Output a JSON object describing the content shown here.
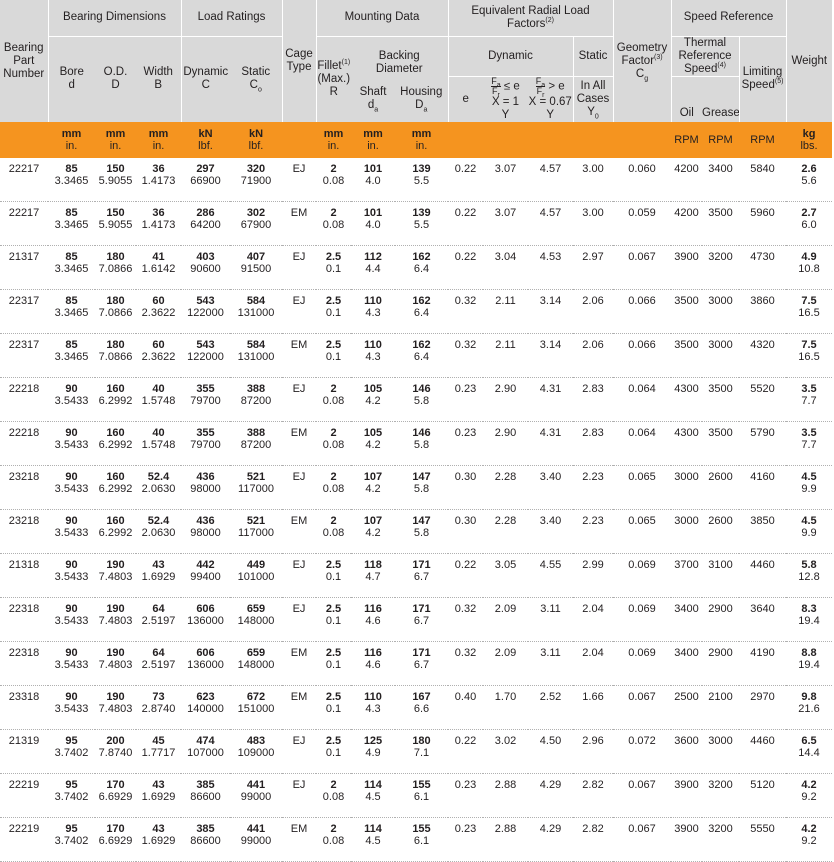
{
  "headers": {
    "bearing_part_number": "Bearing Part Number",
    "bearing_dimensions": "Bearing Dimensions",
    "bore": "Bore",
    "bore_sym": "d",
    "od": "O.D.",
    "od_sym": "D",
    "width": "Width",
    "width_sym": "B",
    "load_ratings": "Load Ratings",
    "dynamic_c": "Dynamic",
    "dynamic_c_sym": "C",
    "static_c": "Static",
    "static_c_sym": "C",
    "static_c_sub": "o",
    "cage_type": "Cage Type",
    "mounting_data": "Mounting Data",
    "fillet": "Fillet",
    "fillet_sup": "(1)",
    "fillet_max": "(Max.)",
    "fillet_sym": "R",
    "backing_diameter": "Backing Diameter",
    "shaft": "Shaft",
    "shaft_sym": "d",
    "shaft_sub": "a",
    "housing": "Housing",
    "housing_sym": "D",
    "housing_sub": "a",
    "erlf": "Equivalent Radial Load Factors",
    "erlf_sup": "(2)",
    "dynamic": "Dynamic",
    "static": "Static",
    "e": "e",
    "dyn1_rel": "≤ e",
    "dyn1_x": "X = 1",
    "dyn1_y": "Y",
    "dyn2_rel": "> e",
    "dyn2_x": "X = 0.67",
    "dyn2_y": "Y",
    "frac_num": "F",
    "frac_num_sub": "a",
    "frac_den": "F",
    "frac_den_sub": "r",
    "in_all_cases": "In All Cases",
    "y0_sym": "Y",
    "y0_sub": "0",
    "geometry_factor": "Geometry Factor",
    "geometry_sup": "(3)",
    "geometry_sym": "C",
    "geometry_sub": "g",
    "speed_reference": "Speed Reference",
    "thermal_reference_speed": "Thermal Reference Speed",
    "thermal_sup": "(4)",
    "oil": "Oil",
    "grease": "Grease",
    "limiting_speed": "Limiting Speed",
    "limiting_sup": "(5)",
    "weight": "Weight"
  },
  "units": {
    "bore": [
      "mm",
      "in."
    ],
    "od": [
      "mm",
      "in."
    ],
    "width": [
      "mm",
      "in."
    ],
    "dynamic_c": [
      "kN",
      "lbf."
    ],
    "static_c": [
      "kN",
      "lbf."
    ],
    "fillet": [
      "mm",
      "in."
    ],
    "shaft": [
      "mm",
      "in."
    ],
    "housing": [
      "mm",
      "in."
    ],
    "oil": "RPM",
    "grease": "RPM",
    "limiting": "RPM",
    "weight": [
      "kg",
      "lbs."
    ]
  },
  "rows": [
    {
      "part": "22217",
      "bore": [
        "85",
        "3.3465"
      ],
      "od": [
        "150",
        "5.9055"
      ],
      "width": [
        "36",
        "1.4173"
      ],
      "dyn": [
        "297",
        "66900"
      ],
      "stat": [
        "320",
        "71900"
      ],
      "cage": "EJ",
      "fillet": [
        "2",
        "0.08"
      ],
      "shaft": [
        "101",
        "4.0"
      ],
      "housing": [
        "139",
        "5.5"
      ],
      "e": "0.22",
      "y1": "3.07",
      "y2": "4.57",
      "y0": "3.00",
      "cg": "0.060",
      "oil": "4200",
      "grease": "3400",
      "limit": "5840",
      "weight": [
        "2.6",
        "5.6"
      ]
    },
    {
      "part": "22217",
      "bore": [
        "85",
        "3.3465"
      ],
      "od": [
        "150",
        "5.9055"
      ],
      "width": [
        "36",
        "1.4173"
      ],
      "dyn": [
        "286",
        "64200"
      ],
      "stat": [
        "302",
        "67900"
      ],
      "cage": "EM",
      "fillet": [
        "2",
        "0.08"
      ],
      "shaft": [
        "101",
        "4.0"
      ],
      "housing": [
        "139",
        "5.5"
      ],
      "e": "0.22",
      "y1": "3.07",
      "y2": "4.57",
      "y0": "3.00",
      "cg": "0.059",
      "oil": "4200",
      "grease": "3500",
      "limit": "5960",
      "weight": [
        "2.7",
        "6.0"
      ]
    },
    {
      "part": "21317",
      "bore": [
        "85",
        "3.3465"
      ],
      "od": [
        "180",
        "7.0866"
      ],
      "width": [
        "41",
        "1.6142"
      ],
      "dyn": [
        "403",
        "90600"
      ],
      "stat": [
        "407",
        "91500"
      ],
      "cage": "EJ",
      "fillet": [
        "2.5",
        "0.1"
      ],
      "shaft": [
        "112",
        "4.4"
      ],
      "housing": [
        "162",
        "6.4"
      ],
      "e": "0.22",
      "y1": "3.04",
      "y2": "4.53",
      "y0": "2.97",
      "cg": "0.067",
      "oil": "3900",
      "grease": "3200",
      "limit": "4730",
      "weight": [
        "4.9",
        "10.8"
      ]
    },
    {
      "part": "22317",
      "bore": [
        "85",
        "3.3465"
      ],
      "od": [
        "180",
        "7.0866"
      ],
      "width": [
        "60",
        "2.3622"
      ],
      "dyn": [
        "543",
        "122000"
      ],
      "stat": [
        "584",
        "131000"
      ],
      "cage": "EJ",
      "fillet": [
        "2.5",
        "0.1"
      ],
      "shaft": [
        "110",
        "4.3"
      ],
      "housing": [
        "162",
        "6.4"
      ],
      "e": "0.32",
      "y1": "2.11",
      "y2": "3.14",
      "y0": "2.06",
      "cg": "0.066",
      "oil": "3500",
      "grease": "3000",
      "limit": "3860",
      "weight": [
        "7.5",
        "16.5"
      ]
    },
    {
      "part": "22317",
      "bore": [
        "85",
        "3.3465"
      ],
      "od": [
        "180",
        "7.0866"
      ],
      "width": [
        "60",
        "2.3622"
      ],
      "dyn": [
        "543",
        "122000"
      ],
      "stat": [
        "584",
        "131000"
      ],
      "cage": "EM",
      "fillet": [
        "2.5",
        "0.1"
      ],
      "shaft": [
        "110",
        "4.3"
      ],
      "housing": [
        "162",
        "6.4"
      ],
      "e": "0.32",
      "y1": "2.11",
      "y2": "3.14",
      "y0": "2.06",
      "cg": "0.066",
      "oil": "3500",
      "grease": "3000",
      "limit": "4320",
      "weight": [
        "7.5",
        "16.5"
      ]
    },
    {
      "part": "22218",
      "bore": [
        "90",
        "3.5433"
      ],
      "od": [
        "160",
        "6.2992"
      ],
      "width": [
        "40",
        "1.5748"
      ],
      "dyn": [
        "355",
        "79700"
      ],
      "stat": [
        "388",
        "87200"
      ],
      "cage": "EJ",
      "fillet": [
        "2",
        "0.08"
      ],
      "shaft": [
        "105",
        "4.2"
      ],
      "housing": [
        "146",
        "5.8"
      ],
      "e": "0.23",
      "y1": "2.90",
      "y2": "4.31",
      "y0": "2.83",
      "cg": "0.064",
      "oil": "4300",
      "grease": "3500",
      "limit": "5520",
      "weight": [
        "3.5",
        "7.7"
      ]
    },
    {
      "part": "22218",
      "bore": [
        "90",
        "3.5433"
      ],
      "od": [
        "160",
        "6.2992"
      ],
      "width": [
        "40",
        "1.5748"
      ],
      "dyn": [
        "355",
        "79700"
      ],
      "stat": [
        "388",
        "87200"
      ],
      "cage": "EM",
      "fillet": [
        "2",
        "0.08"
      ],
      "shaft": [
        "105",
        "4.2"
      ],
      "housing": [
        "146",
        "5.8"
      ],
      "e": "0.23",
      "y1": "2.90",
      "y2": "4.31",
      "y0": "2.83",
      "cg": "0.064",
      "oil": "4300",
      "grease": "3500",
      "limit": "5790",
      "weight": [
        "3.5",
        "7.7"
      ]
    },
    {
      "part": "23218",
      "bore": [
        "90",
        "3.5433"
      ],
      "od": [
        "160",
        "6.2992"
      ],
      "width": [
        "52.4",
        "2.0630"
      ],
      "dyn": [
        "436",
        "98000"
      ],
      "stat": [
        "521",
        "117000"
      ],
      "cage": "EJ",
      "fillet": [
        "2",
        "0.08"
      ],
      "shaft": [
        "107",
        "4.2"
      ],
      "housing": [
        "147",
        "5.8"
      ],
      "e": "0.30",
      "y1": "2.28",
      "y2": "3.40",
      "y0": "2.23",
      "cg": "0.065",
      "oil": "3000",
      "grease": "2600",
      "limit": "4160",
      "weight": [
        "4.5",
        "9.9"
      ]
    },
    {
      "part": "23218",
      "bore": [
        "90",
        "3.5433"
      ],
      "od": [
        "160",
        "6.2992"
      ],
      "width": [
        "52.4",
        "2.0630"
      ],
      "dyn": [
        "436",
        "98000"
      ],
      "stat": [
        "521",
        "117000"
      ],
      "cage": "EM",
      "fillet": [
        "2",
        "0.08"
      ],
      "shaft": [
        "107",
        "4.2"
      ],
      "housing": [
        "147",
        "5.8"
      ],
      "e": "0.30",
      "y1": "2.28",
      "y2": "3.40",
      "y0": "2.23",
      "cg": "0.065",
      "oil": "3000",
      "grease": "2600",
      "limit": "3850",
      "weight": [
        "4.5",
        "9.9"
      ]
    },
    {
      "part": "21318",
      "bore": [
        "90",
        "3.5433"
      ],
      "od": [
        "190",
        "7.4803"
      ],
      "width": [
        "43",
        "1.6929"
      ],
      "dyn": [
        "442",
        "99400"
      ],
      "stat": [
        "449",
        "101000"
      ],
      "cage": "EJ",
      "fillet": [
        "2.5",
        "0.1"
      ],
      "shaft": [
        "118",
        "4.7"
      ],
      "housing": [
        "171",
        "6.7"
      ],
      "e": "0.22",
      "y1": "3.05",
      "y2": "4.55",
      "y0": "2.99",
      "cg": "0.069",
      "oil": "3700",
      "grease": "3100",
      "limit": "4460",
      "weight": [
        "5.8",
        "12.8"
      ]
    },
    {
      "part": "22318",
      "bore": [
        "90",
        "3.5433"
      ],
      "od": [
        "190",
        "7.4803"
      ],
      "width": [
        "64",
        "2.5197"
      ],
      "dyn": [
        "606",
        "136000"
      ],
      "stat": [
        "659",
        "148000"
      ],
      "cage": "EJ",
      "fillet": [
        "2.5",
        "0.1"
      ],
      "shaft": [
        "116",
        "4.6"
      ],
      "housing": [
        "171",
        "6.7"
      ],
      "e": "0.32",
      "y1": "2.09",
      "y2": "3.11",
      "y0": "2.04",
      "cg": "0.069",
      "oil": "3400",
      "grease": "2900",
      "limit": "3640",
      "weight": [
        "8.3",
        "19.4"
      ]
    },
    {
      "part": "22318",
      "bore": [
        "90",
        "3.5433"
      ],
      "od": [
        "190",
        "7.4803"
      ],
      "width": [
        "64",
        "2.5197"
      ],
      "dyn": [
        "606",
        "136000"
      ],
      "stat": [
        "659",
        "148000"
      ],
      "cage": "EM",
      "fillet": [
        "2.5",
        "0.1"
      ],
      "shaft": [
        "116",
        "4.6"
      ],
      "housing": [
        "171",
        "6.7"
      ],
      "e": "0.32",
      "y1": "2.09",
      "y2": "3.11",
      "y0": "2.04",
      "cg": "0.069",
      "oil": "3400",
      "grease": "2900",
      "limit": "4190",
      "weight": [
        "8.8",
        "19.4"
      ]
    },
    {
      "part": "23318",
      "bore": [
        "90",
        "3.5433"
      ],
      "od": [
        "190",
        "7.4803"
      ],
      "width": [
        "73",
        "2.8740"
      ],
      "dyn": [
        "623",
        "140000"
      ],
      "stat": [
        "672",
        "151000"
      ],
      "cage": "EM",
      "fillet": [
        "2.5",
        "0.1"
      ],
      "shaft": [
        "110",
        "4.3"
      ],
      "housing": [
        "167",
        "6.6"
      ],
      "e": "0.40",
      "y1": "1.70",
      "y2": "2.52",
      "y0": "1.66",
      "cg": "0.067",
      "oil": "2500",
      "grease": "2100",
      "limit": "2970",
      "weight": [
        "9.8",
        "21.6"
      ]
    },
    {
      "part": "21319",
      "bore": [
        "95",
        "3.7402"
      ],
      "od": [
        "200",
        "7.8740"
      ],
      "width": [
        "45",
        "1.7717"
      ],
      "dyn": [
        "474",
        "107000"
      ],
      "stat": [
        "483",
        "109000"
      ],
      "cage": "EJ",
      "fillet": [
        "2.5",
        "0.1"
      ],
      "shaft": [
        "125",
        "4.9"
      ],
      "housing": [
        "180",
        "7.1"
      ],
      "e": "0.22",
      "y1": "3.02",
      "y2": "4.50",
      "y0": "2.96",
      "cg": "0.072",
      "oil": "3600",
      "grease": "3000",
      "limit": "4460",
      "weight": [
        "6.5",
        "14.4"
      ]
    },
    {
      "part": "22219",
      "bore": [
        "95",
        "3.7402"
      ],
      "od": [
        "170",
        "6.6929"
      ],
      "width": [
        "43",
        "1.6929"
      ],
      "dyn": [
        "385",
        "86600"
      ],
      "stat": [
        "441",
        "99000"
      ],
      "cage": "EJ",
      "fillet": [
        "2",
        "0.08"
      ],
      "shaft": [
        "114",
        "4.5"
      ],
      "housing": [
        "155",
        "6.1"
      ],
      "e": "0.23",
      "y1": "2.88",
      "y2": "4.29",
      "y0": "2.82",
      "cg": "0.067",
      "oil": "3900",
      "grease": "3200",
      "limit": "5120",
      "weight": [
        "4.2",
        "9.2"
      ]
    },
    {
      "part": "22219",
      "bore": [
        "95",
        "3.7402"
      ],
      "od": [
        "170",
        "6.6929"
      ],
      "width": [
        "43",
        "1.6929"
      ],
      "dyn": [
        "385",
        "86600"
      ],
      "stat": [
        "441",
        "99000"
      ],
      "cage": "EM",
      "fillet": [
        "2",
        "0.08"
      ],
      "shaft": [
        "114",
        "4.5"
      ],
      "housing": [
        "155",
        "6.1"
      ],
      "e": "0.23",
      "y1": "2.88",
      "y2": "4.29",
      "y0": "2.82",
      "cg": "0.067",
      "oil": "3900",
      "grease": "3200",
      "limit": "5550",
      "weight": [
        "4.2",
        "9.2"
      ]
    }
  ]
}
